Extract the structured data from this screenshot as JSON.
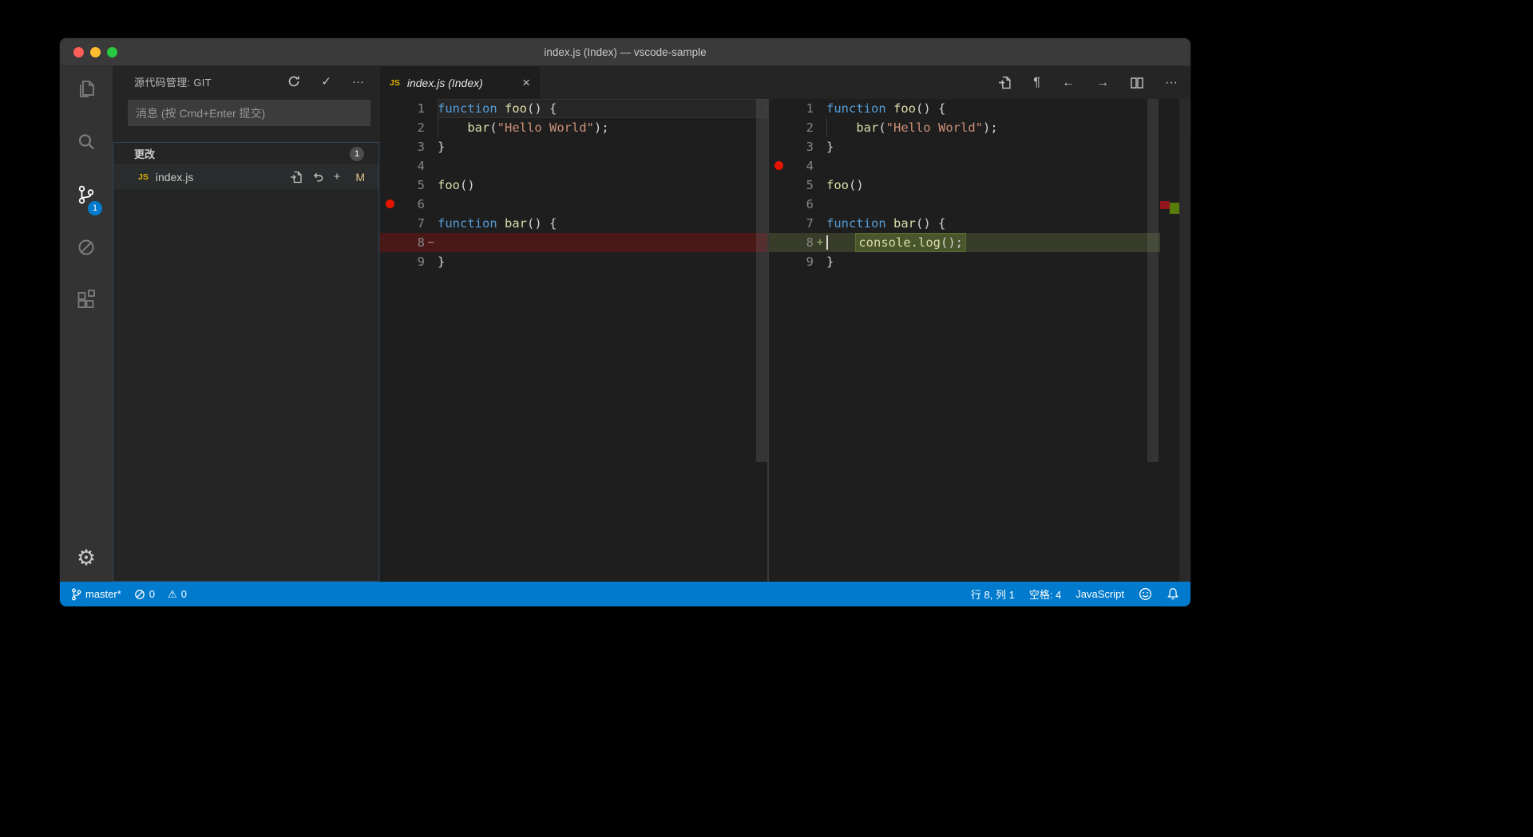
{
  "colors": {
    "accent": "#007acc",
    "statusbar-bg": "#007acc",
    "titlebar-bg": "#3a3a3a",
    "activitybar-bg": "#333333",
    "sidebar-bg": "#252526",
    "editor-bg": "#1e1e1e",
    "tabbar-bg": "#252526",
    "removed-line-bg": "#4b1818",
    "added-line-bg": "#373d29",
    "added-char-bg": "#49552b",
    "added-char-border": "#5d6b33",
    "breakpoint-red": "#e51400",
    "keyword": "#569cd6",
    "function": "#dcdcaa",
    "string": "#ce9178",
    "code-fg": "#d4d4d4",
    "line-number": "#858585",
    "js-icon": "#ddb100",
    "git-modified": "#e2c08d",
    "ruler-removed": "#94151b",
    "ruler-added": "#587c0c"
  },
  "window": {
    "title": "index.js (Index) — vscode-sample"
  },
  "activity_bar": {
    "source_control_badge": "1"
  },
  "sidebar": {
    "title": "源代码管理: GIT",
    "commit_placeholder": "消息 (按 Cmd+Enter 提交)",
    "changes_label": "更改",
    "changes_count": "1",
    "file_name": "index.js",
    "file_icon_label": "JS",
    "file_status": "M"
  },
  "editor": {
    "tab_label": "index.js (Index)",
    "tab_icon_label": "JS"
  },
  "icons": {
    "commit_check": "✓",
    "more": "···",
    "stage": "+",
    "close_tab": "×",
    "pilcrow": "¶",
    "back": "←",
    "forward": "→",
    "gear": "⚙",
    "warning": "⚠"
  },
  "code": {
    "original_lines": [
      {
        "num": "1",
        "current": true,
        "segs": [
          [
            "kw",
            "function"
          ],
          [
            "pl",
            " "
          ],
          [
            "fn",
            "foo"
          ],
          [
            "pl",
            "() {"
          ]
        ]
      },
      {
        "num": "2",
        "guide": true,
        "segs": [
          [
            "pl",
            "    "
          ],
          [
            "fn",
            "bar"
          ],
          [
            "pl",
            "("
          ],
          [
            "str",
            "\"Hello World\""
          ],
          [
            "pl",
            ");"
          ]
        ]
      },
      {
        "num": "3",
        "segs": [
          [
            "pl",
            "}"
          ]
        ]
      },
      {
        "num": "4",
        "segs": []
      },
      {
        "num": "5",
        "segs": [
          [
            "fn",
            "foo"
          ],
          [
            "pl",
            "()"
          ]
        ]
      },
      {
        "num": "6",
        "glyph": "breakpoint",
        "segs": []
      },
      {
        "num": "7",
        "segs": [
          [
            "kw",
            "function"
          ],
          [
            "pl",
            " "
          ],
          [
            "fn",
            "bar"
          ],
          [
            "pl",
            "() {"
          ]
        ]
      },
      {
        "num": "8",
        "diff": "removed",
        "marker": "−",
        "segs": []
      },
      {
        "num": "9",
        "segs": [
          [
            "pl",
            "}"
          ]
        ]
      }
    ],
    "modified_lines": [
      {
        "num": "1",
        "segs": [
          [
            "kw",
            "function"
          ],
          [
            "pl",
            " "
          ],
          [
            "fn",
            "foo"
          ],
          [
            "pl",
            "() {"
          ]
        ]
      },
      {
        "num": "2",
        "guide": true,
        "segs": [
          [
            "pl",
            "    "
          ],
          [
            "fn",
            "bar"
          ],
          [
            "pl",
            "("
          ],
          [
            "str",
            "\"Hello World\""
          ],
          [
            "pl",
            ");"
          ]
        ]
      },
      {
        "num": "3",
        "segs": [
          [
            "pl",
            "}"
          ]
        ]
      },
      {
        "num": "4",
        "glyph": "breakpoint",
        "segs": []
      },
      {
        "num": "5",
        "segs": [
          [
            "fn",
            "foo"
          ],
          [
            "pl",
            "()"
          ]
        ]
      },
      {
        "num": "6",
        "segs": []
      },
      {
        "num": "7",
        "segs": [
          [
            "kw",
            "function"
          ],
          [
            "pl",
            " "
          ],
          [
            "fn",
            "bar"
          ],
          [
            "pl",
            "() {"
          ]
        ]
      },
      {
        "num": "8",
        "diff": "added",
        "marker": "+",
        "cursor": true,
        "segs": [
          [
            "pl",
            "    "
          ],
          [
            "cons",
            "console",
            1
          ],
          [
            "pl",
            ".",
            1
          ],
          [
            "fn",
            "log",
            1
          ],
          [
            "pl",
            "();",
            1
          ]
        ]
      },
      {
        "num": "9",
        "segs": [
          [
            "pl",
            "}"
          ]
        ]
      }
    ]
  },
  "status_bar": {
    "branch": "master*",
    "error_count": "0",
    "warning_count": "0",
    "cursor_position": "行 8, 列 1",
    "indentation": "空格: 4",
    "language": "JavaScript"
  }
}
